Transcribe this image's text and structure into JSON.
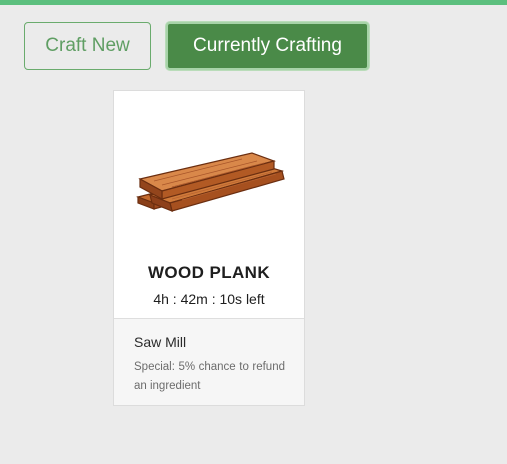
{
  "tabs": {
    "craft_new": "Craft New",
    "currently_crafting": "Currently Crafting"
  },
  "colors": {
    "accent_bar": "#5cbf7e",
    "active_tab": "#4a8a48",
    "inactive_tab_text": "#5f9e63"
  },
  "crafting_card": {
    "item_icon": "wood-plank-icon",
    "item_name": "WOOD PLANK",
    "time_left": "4h : 42m : 10s left",
    "building": "Saw Mill",
    "special": "Special: 5% chance to refund an ingredient"
  }
}
